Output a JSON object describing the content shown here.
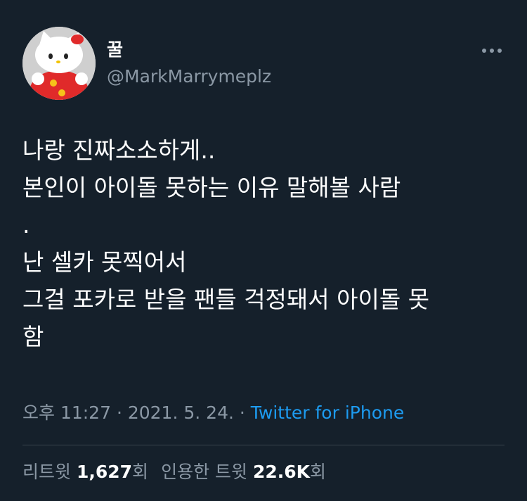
{
  "tweet": {
    "display_name": "꿀",
    "handle": "@MarkMarrymeplz",
    "more_icon": "more-horizontal-icon",
    "lines": [
      "나랑 진짜소소하게..",
      "본인이 아이돌 못하는 이유 말해볼 사람",
      ".",
      "난 셀카 못찍어서",
      "그걸 포카로 받을 팬들 걱정돼서 아이돌 못",
      "함"
    ],
    "time": "오후 11:27",
    "separator": " · ",
    "date": "2021. 5. 24.",
    "source": "Twitter for iPhone",
    "retweets_label": "리트윗",
    "retweets_count": "1,627",
    "retweets_suffix": "회",
    "quotes_label": "인용한 트윗",
    "quotes_count": "22.6K",
    "quotes_suffix": "회"
  },
  "colors": {
    "background": "#15202b",
    "primary_text": "#ffffff",
    "secondary_text": "#8b98a5",
    "link": "#1d9bf0",
    "divider": "#38444d"
  }
}
